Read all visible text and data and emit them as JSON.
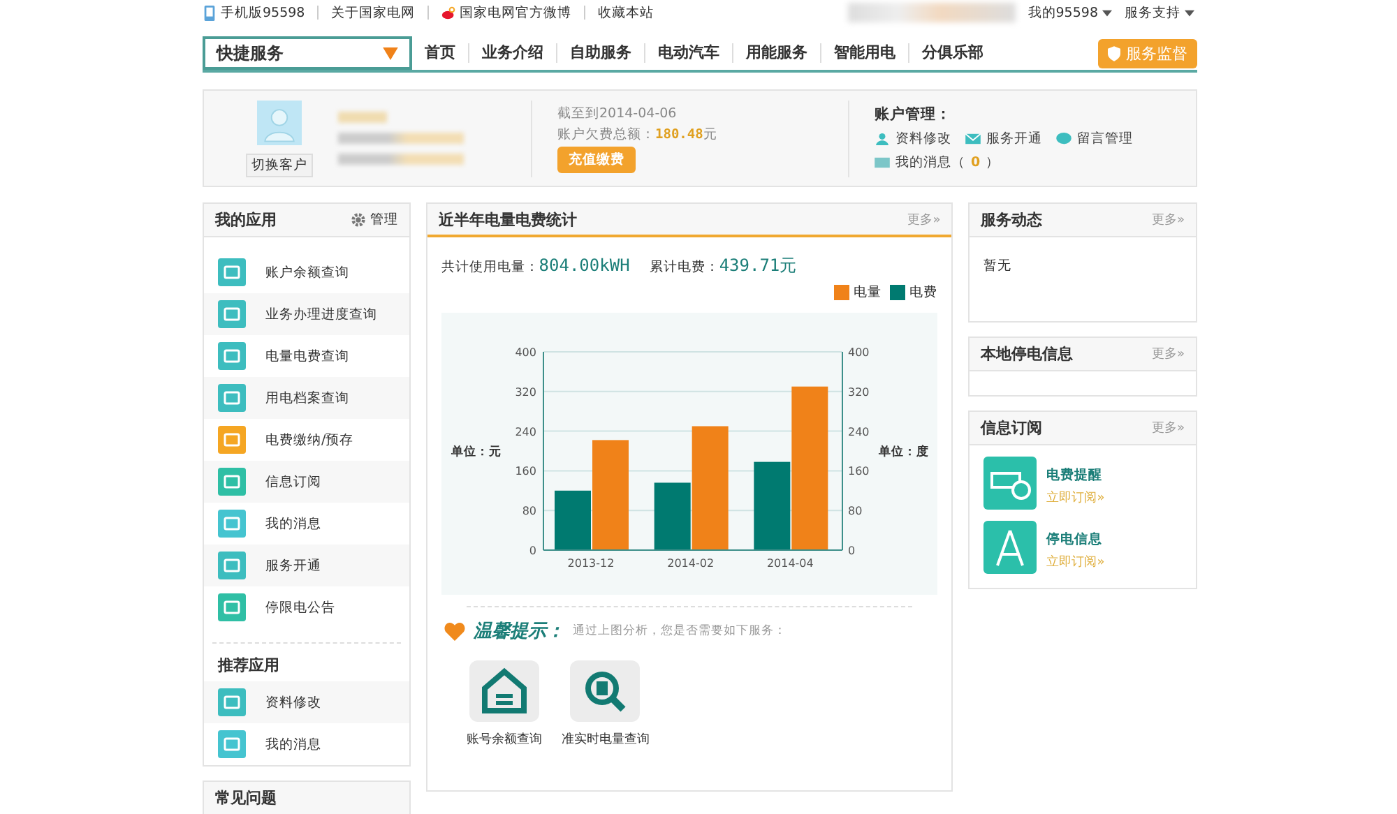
{
  "top_links": [
    "手机版95598",
    "关于国家电网",
    "国家电网官方微博",
    "收藏本站"
  ],
  "top_right": [
    "我的95598",
    "服务支持"
  ],
  "quick_service": "快捷服务",
  "nav": [
    "首页",
    "业务介绍",
    "自助服务",
    "电动汽车",
    "用能服务",
    "智能用电",
    "分俱乐部"
  ],
  "supervise_button": "服务监督",
  "account": {
    "switch_button": "切换客户",
    "date": "截至到2014-04-06",
    "owed_label": "账户欠费总额：",
    "owed_value": "180.48",
    "owed_unit": "元",
    "pay_button": "充值缴费",
    "manage_title": "账户管理：",
    "links": [
      "资料修改",
      "服务开通",
      "留言管理"
    ],
    "messages_label": "我的消息（",
    "messages_count": "0",
    "messages_end": "）"
  },
  "my_apps": {
    "title": "我的应用",
    "manage": "管理",
    "items": [
      {
        "label": "账户余额查询",
        "color": "#3dbdbf"
      },
      {
        "label": "业务办理进度查询",
        "color": "#3dbdbf"
      },
      {
        "label": "电量电费查询",
        "color": "#3dbdbf"
      },
      {
        "label": "用电档案查询",
        "color": "#3dbdbf"
      },
      {
        "label": "电费缴纳/预存",
        "color": "#f5a623"
      },
      {
        "label": "信息订阅",
        "color": "#2fbfa5"
      },
      {
        "label": "我的消息",
        "color": "#45c4d0"
      },
      {
        "label": "服务开通",
        "color": "#3dbdbf"
      },
      {
        "label": "停限电公告",
        "color": "#2fbfa5"
      }
    ]
  },
  "recommended": {
    "title": "推荐应用",
    "items": [
      {
        "label": "资料修改",
        "color": "#3dbdbf"
      },
      {
        "label": "我的消息",
        "color": "#45c4d0"
      }
    ]
  },
  "faq_title": "常见问题",
  "stats": {
    "title": "近半年电量电费统计",
    "more": "更多»",
    "usage_label": "共计使用电量：",
    "usage_value": "804.00kWH",
    "fee_label": "累计电费：",
    "fee_value": "439.71元",
    "chart_data": {
      "type": "bar",
      "categories": [
        "2013-12",
        "2014-02",
        "2014-04"
      ],
      "series": [
        {
          "name": "电量",
          "color": "#f08219",
          "values": [
            222,
            250,
            330
          ]
        },
        {
          "name": "电费",
          "color": "#007a70",
          "values": [
            120,
            136,
            178
          ]
        }
      ],
      "ylim": [
        0,
        400
      ],
      "yticks": [
        0,
        80,
        160,
        240,
        320,
        400
      ],
      "y2ticks": [
        0,
        80,
        160,
        240,
        320,
        400
      ],
      "y2lim": [
        0,
        400
      ],
      "grid": true,
      "ylabel": "单位：元",
      "y2label": "单位：度"
    },
    "tip_title": "温馨提示：",
    "tip_text": "通过上图分析，您是否需要如下服务：",
    "services": [
      "账号余额查询",
      "准实时电量查询"
    ]
  },
  "service_news": {
    "title": "服务动态",
    "more": "更多»",
    "text": "暂无"
  },
  "outage": {
    "title": "本地停电信息",
    "more": "更多»"
  },
  "subscribe": {
    "title": "信息订阅",
    "more": "更多»",
    "items": [
      {
        "name": "电费提醒",
        "action": "立即订阅»"
      },
      {
        "name": "停电信息",
        "action": "立即订阅»"
      }
    ]
  }
}
